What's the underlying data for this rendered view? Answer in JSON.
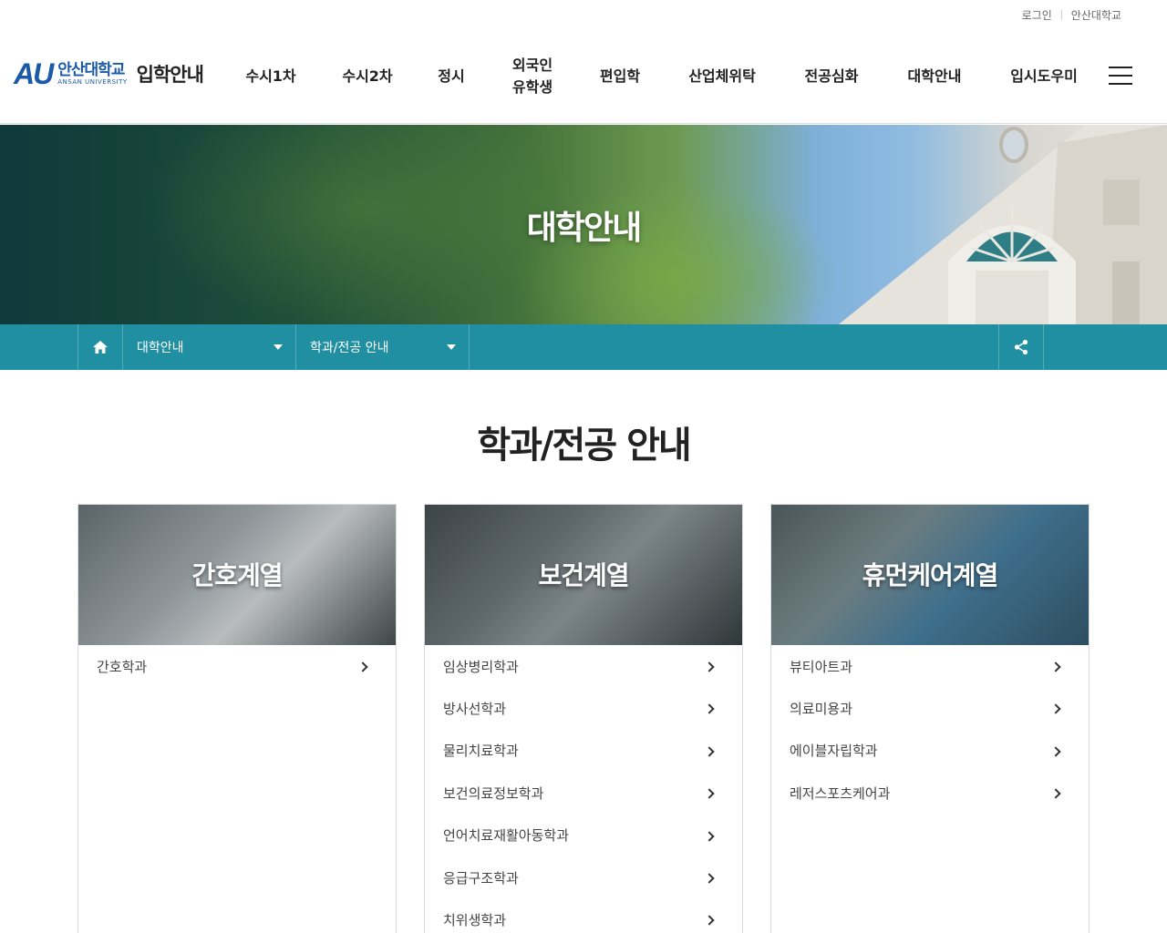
{
  "util": {
    "login": "로그인",
    "university": "안산대학교"
  },
  "logo": {
    "mark": "AU",
    "name_ko": "안산대학교",
    "name_en": "ANSAN UNIVERSITY",
    "section": "입학안내"
  },
  "gnb": [
    "수시1차",
    "수시2차",
    "정시",
    "외국인\n유학생",
    "편입학",
    "산업체위탁",
    "전공심화",
    "대학안내",
    "입시도우미"
  ],
  "hero": {
    "title": "대학안내"
  },
  "location": {
    "depth1": "대학안내",
    "depth2": "학과/전공 안내"
  },
  "page_title": "학과/전공 안내",
  "cards": [
    {
      "title": "간호계열",
      "items": [
        "간호학과"
      ]
    },
    {
      "title": "보건계열",
      "items": [
        "임상병리학과",
        "방사선학과",
        "물리치료학과",
        "보건의료정보학과",
        "언어치료재활아동학과",
        "응급구조학과",
        "치위생학과"
      ]
    },
    {
      "title": "휴먼케어계열",
      "items": [
        "뷰티아트과",
        "의료미용과",
        "에이블자립학과",
        "레저스포츠케어과"
      ]
    }
  ],
  "colors": {
    "brand": "#1b5aa8",
    "location_bar": "#1f8fa1"
  },
  "icons": {
    "home": "home-icon",
    "share": "share-icon",
    "menu": "hamburger-menu-icon",
    "caret": "caret-down-icon",
    "arrow": "chevron-right-icon"
  }
}
